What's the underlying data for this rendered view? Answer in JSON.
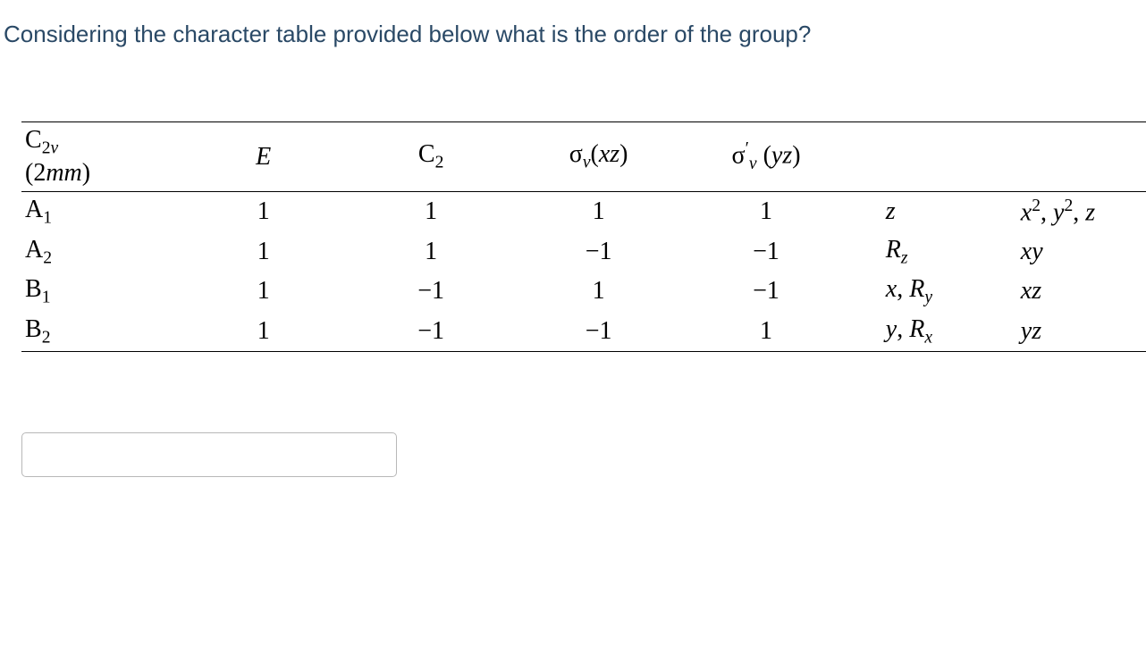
{
  "question": "Considering the character table provided below what is the order of the group?",
  "table": {
    "header": {
      "group_html": "C<span class='sub'>2<span class='italic'>v</span></span>",
      "group_sub_html": "(2<span class='italic'>mm</span>)",
      "ops": {
        "E": "E",
        "C2_html": "C<span class='sub'>2</span>",
        "sigma_v_xz_html": "σ<span class='sub italic'>v</span>(<span class='italic'>xz</span>)",
        "sigma_v_yz_html": "σ<span class='sup'>′</span><span class='sub italic'>v</span> (<span class='italic'>yz</span>)"
      }
    },
    "rows": [
      {
        "irrep_html": "A<span class='sub'>1</span>",
        "E": "1",
        "C2": "1",
        "sxz": "1",
        "syz": "1",
        "linear_html": "<span class='italic'>z</span>",
        "quad_html": "<span class='italic'>x</span><span class='sup'>2</span>, <span class='italic'>y</span><span class='sup'>2</span>, <span class='italic'>z</span>"
      },
      {
        "irrep_html": "A<span class='sub'>2</span>",
        "E": "1",
        "C2": "1",
        "sxz": "−1",
        "syz": "−1",
        "linear_html": "<span class='italic'>R<span class='sub'>z</span></span>",
        "quad_html": "<span class='italic'>xy</span>"
      },
      {
        "irrep_html": "B<span class='sub'>1</span>",
        "E": "1",
        "C2": "−1",
        "sxz": "1",
        "syz": "−1",
        "linear_html": "<span class='italic'>x</span>, <span class='italic'>R<span class='sub'>y</span></span>",
        "quad_html": "<span class='italic'>xz</span>"
      },
      {
        "irrep_html": "B<span class='sub'>2</span>",
        "E": "1",
        "C2": "−1",
        "sxz": "−1",
        "syz": "1",
        "linear_html": "<span class='italic'>y</span>, <span class='italic'>R<span class='sub'>x</span></span>",
        "quad_html": "<span class='italic'>yz</span>"
      }
    ]
  },
  "answer": {
    "value": "",
    "placeholder": ""
  }
}
